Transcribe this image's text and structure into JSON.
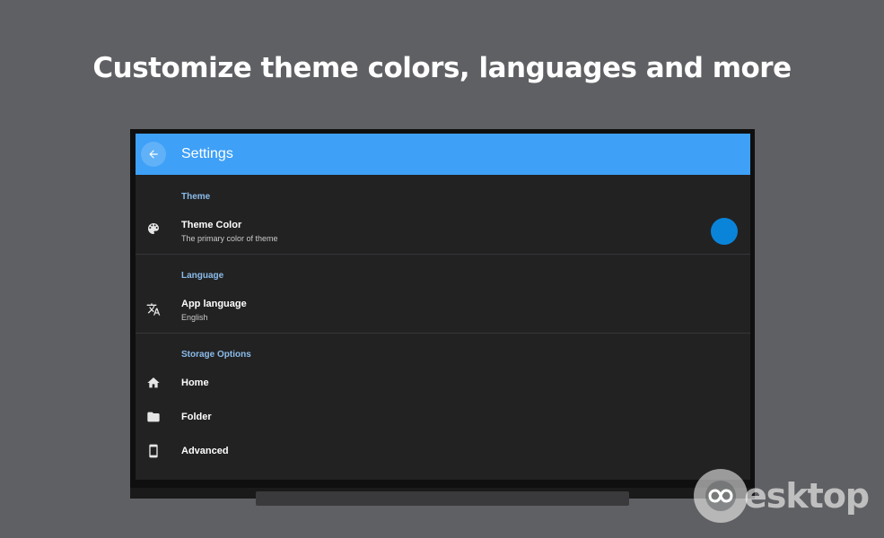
{
  "headline": "Customize theme colors, languages and more",
  "appbar": {
    "title": "Settings",
    "back_icon": "arrow-back-icon",
    "color": "#3ea0f7"
  },
  "sections": {
    "theme": {
      "header": "Theme",
      "theme_color": {
        "title": "Theme Color",
        "subtitle": "The primary color of theme",
        "icon": "palette-icon",
        "swatch_color": "#0a84d8"
      }
    },
    "language": {
      "header": "Language",
      "app_language": {
        "title": "App language",
        "value": "English",
        "icon": "translate-icon"
      }
    },
    "storage": {
      "header": "Storage Options",
      "items": [
        {
          "label": "Home",
          "icon": "home-icon"
        },
        {
          "label": "Folder",
          "icon": "folder-icon"
        },
        {
          "label": "Advanced",
          "icon": "phone-device-icon"
        }
      ]
    }
  },
  "watermark": {
    "text": "esktop",
    "logo_letter": "D"
  }
}
